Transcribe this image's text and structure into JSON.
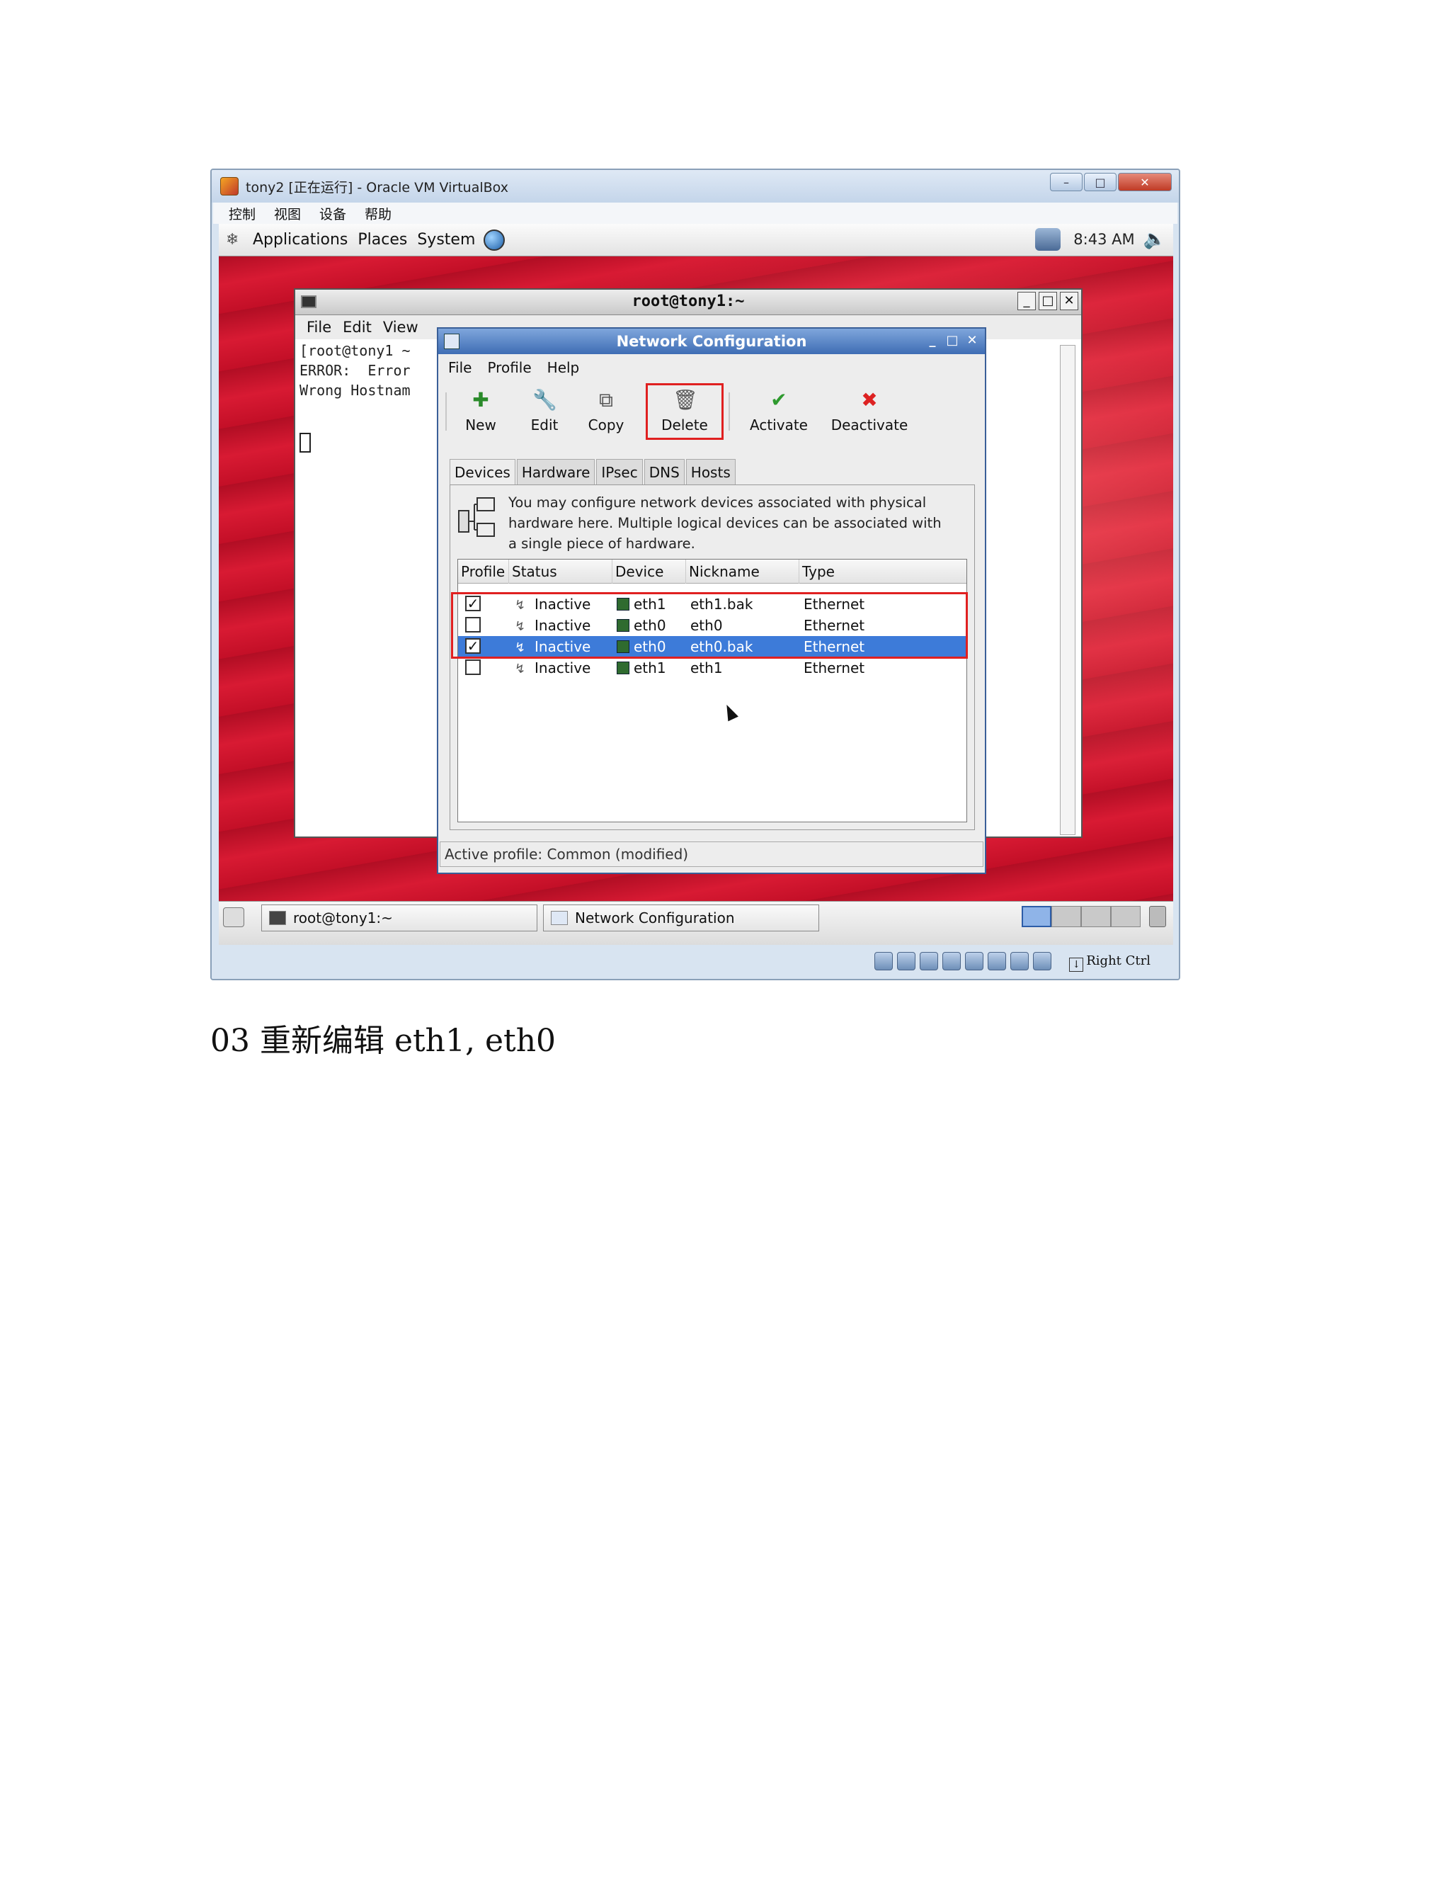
{
  "vbox": {
    "title": "tony2 [正在运行] - Oracle VM VirtualBox",
    "menu": [
      "控制",
      "视图",
      "设备",
      "帮助"
    ],
    "host_key": "Right Ctrl"
  },
  "guest": {
    "panel": {
      "applications": "Applications",
      "places": "Places",
      "system": "System",
      "clock": "8:43 AM"
    },
    "terminal": {
      "title": "root@tony1:~",
      "menu": [
        "File",
        "Edit",
        "View"
      ],
      "lines": [
        "[root@tony1 ~",
        "ERROR:  Error",
        "Wrong Hostnam"
      ]
    },
    "netconfig": {
      "title": "Network Configuration",
      "menu": [
        "File",
        "Profile",
        "Help"
      ],
      "toolbar": {
        "new": "New",
        "edit": "Edit",
        "copy": "Copy",
        "delete": "Delete",
        "activate": "Activate",
        "deactivate": "Deactivate"
      },
      "tabs": [
        "Devices",
        "Hardware",
        "IPsec",
        "DNS",
        "Hosts"
      ],
      "description": "You may configure network devices associated with physical hardware here.  Multiple logical devices can be associated with a single piece of hardware.",
      "columns": {
        "profile": "Profile",
        "status": "Status",
        "device": "Device",
        "nickname": "Nickname",
        "type": "Type"
      },
      "rows": [
        {
          "checked": true,
          "status": "Inactive",
          "device": "eth1",
          "nickname": "eth1.bak",
          "type": "Ethernet"
        },
        {
          "checked": false,
          "status": "Inactive",
          "device": "eth0",
          "nickname": "eth0",
          "type": "Ethernet"
        },
        {
          "checked": true,
          "status": "Inactive",
          "device": "eth0",
          "nickname": "eth0.bak",
          "type": "Ethernet"
        },
        {
          "checked": false,
          "status": "Inactive",
          "device": "eth1",
          "nickname": "eth1",
          "type": "Ethernet"
        }
      ],
      "status_bar": "Active profile: Common (modified)"
    },
    "taskbar": {
      "terminal": "root@tony1:~",
      "netconfig": "Network Configuration"
    }
  },
  "caption": "03 重新编辑 eth1, eth0",
  "colors": {
    "desktop_red": "#c8102e",
    "selection_blue": "#3d7bd9",
    "highlight_red": "#e02020"
  }
}
